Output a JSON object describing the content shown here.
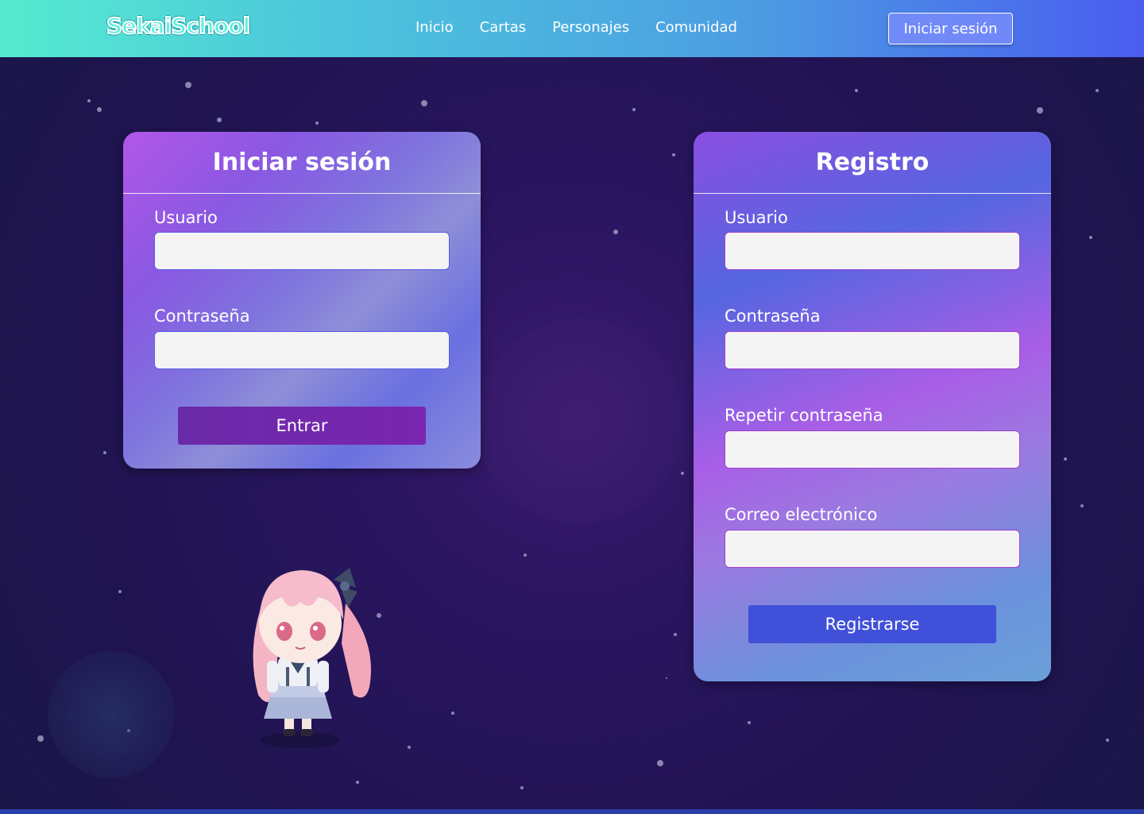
{
  "navbar": {
    "logo": "SekaiSchool",
    "links": [
      "Inicio",
      "Cartas",
      "Personajes",
      "Comunidad"
    ],
    "login_button": "Iniciar sesión"
  },
  "login_form": {
    "title": "Iniciar sesión",
    "username_label": "Usuario",
    "username_value": "",
    "password_label": "Contraseña",
    "password_value": "",
    "submit_label": "Entrar"
  },
  "register_form": {
    "title": "Registro",
    "username_label": "Usuario",
    "username_value": "",
    "password_label": "Contraseña",
    "password_value": "",
    "repeat_password_label": "Repetir contraseña",
    "repeat_password_value": "",
    "email_label": "Correo electrónico",
    "email_value": "",
    "submit_label": "Registrarse"
  },
  "mascot": {
    "icon": "chibi-character"
  },
  "colors": {
    "navbar_start": "#55ebd0",
    "navbar_end": "#4a5cf0",
    "background": "#1f1450",
    "login_button": "#6a2aa8",
    "register_button": "#4150d8"
  }
}
